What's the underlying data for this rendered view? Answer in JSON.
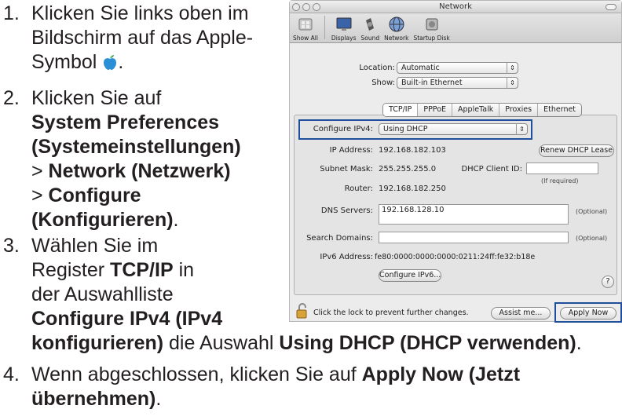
{
  "steps": {
    "s1_num": "1.",
    "s1_line1": "Klicken Sie links oben im",
    "s1_line2": "Bildschirm auf das Apple-",
    "s1_line3": "Symbol",
    "s1_dot": ".",
    "s2_num": "2.",
    "s2_line1": "Klicken Sie auf",
    "s2_line2": "System Preferences",
    "s2_line3": "(Systemeinstellungen)",
    "s2_line4_pre": "> ",
    "s2_line4": "Network (Netzwerk)",
    "s2_line5_pre": "> ",
    "s2_line5": "Configure",
    "s2_line6": "(Konfigurieren)",
    "s2_line6_post": ".",
    "s3_num": "3.",
    "s3_line1": "Wählen Sie im",
    "s3_line2_pre": "Register ",
    "s3_line2": "TCP/IP",
    "s3_line2_post": " in",
    "s3_line3": "der Auswahlliste",
    "s3_line4": "Configure IPv4 (IPv4",
    "s3_line5": "konfigurieren)",
    "s3_line5_mid": " die Auswahl ",
    "s3_line5_b": "Using DHCP (DHCP verwenden)",
    "s3_line5_post": ".",
    "s4_num": "4.",
    "s4_line1_pre": "Wenn abgeschlossen, klicken Sie auf ",
    "s4_line1": "Apply Now (Jetzt",
    "s4_line2": "übernehmen)",
    "s4_line2_post": "."
  },
  "window": {
    "title": "Network",
    "toolbar": {
      "show_all": "Show All",
      "displays": "Displays",
      "sound": "Sound",
      "network": "Network",
      "startup_disk": "Startup Disk"
    },
    "location_label": "Location:",
    "location_value": "Automatic",
    "show_label": "Show:",
    "show_value": "Built-in Ethernet",
    "tabs": [
      "TCP/IP",
      "PPPoE",
      "AppleTalk",
      "Proxies",
      "Ethernet"
    ],
    "configure_label": "Configure IPv4:",
    "configure_value": "Using DHCP",
    "ip_label": "IP Address:",
    "ip_value": "192.168.182.103",
    "renew_button": "Renew DHCP Lease",
    "subnet_label": "Subnet Mask:",
    "subnet_value": "255.255.255.0",
    "client_id_label": "DHCP Client ID:",
    "client_id_value": "",
    "if_required": "(If required)",
    "router_label": "Router:",
    "router_value": "192.168.182.250",
    "dns_label": "DNS Servers:",
    "dns_value": "192.168.128.10",
    "optional": "(Optional)",
    "search_label": "Search Domains:",
    "search_value": "",
    "ipv6_label": "IPv6 Address:",
    "ipv6_value": "fe80:0000:0000:0000:0211:24ff:fe32:b18e",
    "configure_ipv6_button": "Configure IPv6...",
    "help": "?",
    "lock_text": "Click the lock to prevent further changes.",
    "assist_button": "Assist me...",
    "apply_button": "Apply Now"
  },
  "colors": {
    "highlight": "#1f4e9a",
    "apple_icon": "#2b8fd6"
  }
}
